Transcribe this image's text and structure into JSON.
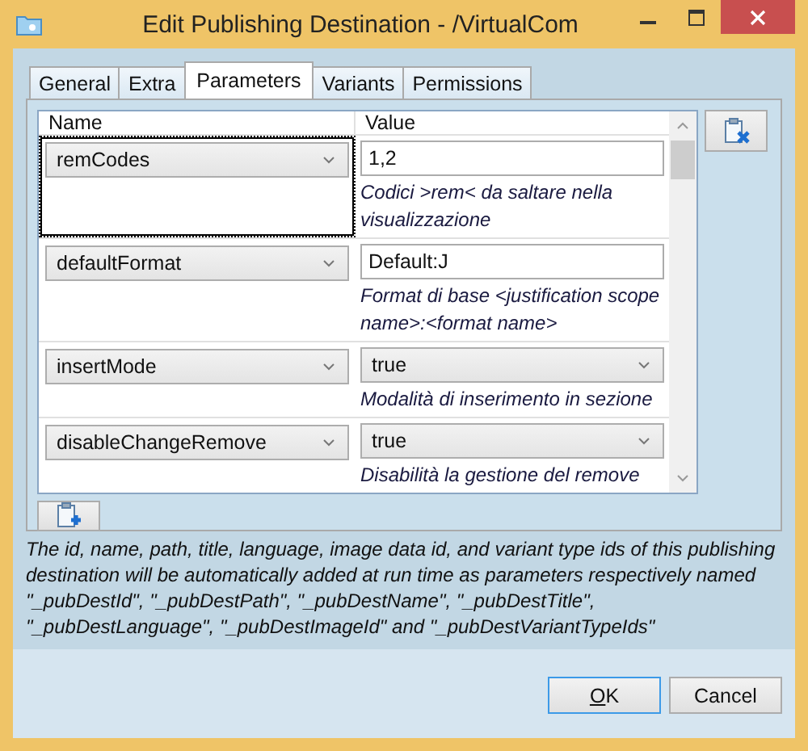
{
  "window": {
    "title": "Edit Publishing Destination - /VirtualCom"
  },
  "tabs": [
    {
      "label": "General",
      "selected": false
    },
    {
      "label": "Extra",
      "selected": false
    },
    {
      "label": "Parameters",
      "selected": true
    },
    {
      "label": "Variants",
      "selected": false
    },
    {
      "label": "Permissions",
      "selected": false
    }
  ],
  "grid": {
    "columns": [
      "Name",
      "Value"
    ],
    "rows": [
      {
        "name": "remCodes",
        "selected": true,
        "value": {
          "kind": "text",
          "text": "1,2"
        },
        "description": "Codici >rem< da saltare nella visualizzazione"
      },
      {
        "name": "defaultFormat",
        "selected": false,
        "value": {
          "kind": "text",
          "text": "Default:J"
        },
        "description": "Format di base <justification scope name>:<format name>"
      },
      {
        "name": "insertMode",
        "selected": false,
        "value": {
          "kind": "combo",
          "text": "true"
        },
        "description": "Modalità di inserimento in sezione"
      },
      {
        "name": "disableChangeRemove",
        "selected": false,
        "value": {
          "kind": "combo",
          "text": "true"
        },
        "description": "Disabilità la gestione del remove"
      }
    ]
  },
  "note": "The id, name, path, title, language, image data id, and variant type ids of this publishing destination will be automatically added at run time as parameters respectively named \"_pubDestId\", \"_pubDestPath\", \"_pubDestName\", \"_pubDestTitle\", \"_pubDestLanguage\", \"_pubDestImageId\" and \"_pubDestVariantTypeIds\"",
  "buttons": [
    {
      "label": "OK",
      "default": true,
      "mnemonic_underlined": true
    },
    {
      "label": "Cancel",
      "default": false
    }
  ]
}
